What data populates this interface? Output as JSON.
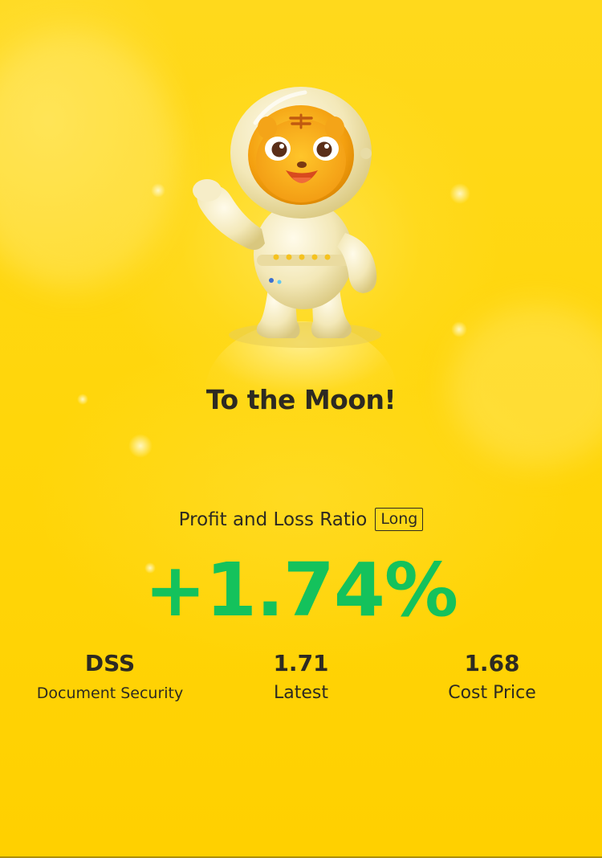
{
  "card": {
    "title": "To the Moon!",
    "mascot_icon": "astronaut-tiger-mascot",
    "ratio_label": "Profit and Loss Ratio",
    "position_badge": "Long",
    "ratio_value": "+1.74%",
    "stats": [
      {
        "value": "DSS",
        "label": "Document Security"
      },
      {
        "value": "1.71",
        "label": "Latest"
      },
      {
        "value": "1.68",
        "label": "Cost Price"
      }
    ]
  },
  "colors": {
    "background": "#FFD60A",
    "profit_green": "#14C25C",
    "text_dark": "#2D2A22"
  }
}
